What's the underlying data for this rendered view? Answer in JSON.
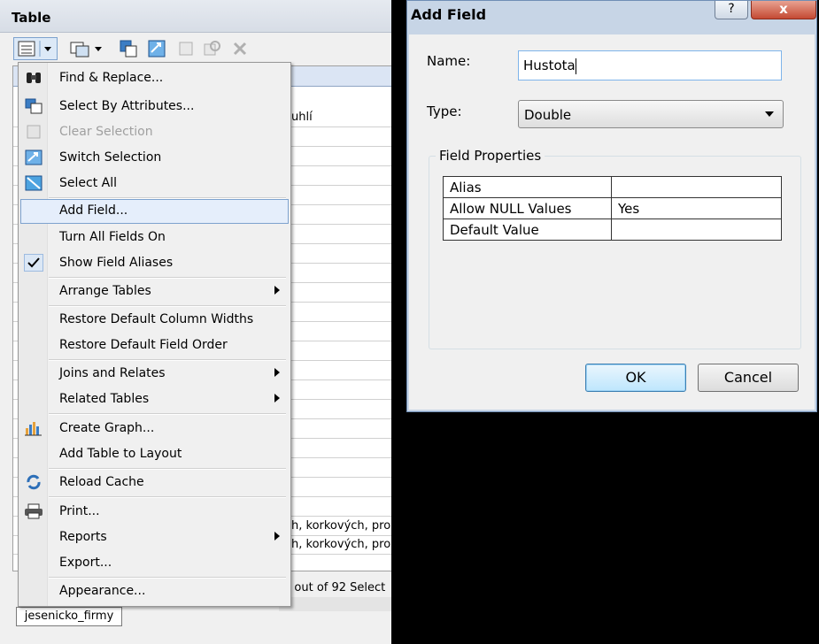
{
  "table_window": {
    "title": "Table",
    "tab_label": "jesenicko_firmy",
    "status_text": "0 out of 92 Select",
    "cell_values": [
      "uhlí",
      "h, korkových, pro",
      "h, korkových, pro"
    ]
  },
  "context_menu": {
    "items": [
      {
        "label": "Find & Replace...",
        "icon": "binoculars-icon"
      },
      {
        "label": "Select By Attributes...",
        "icon": "select-by-attributes-icon"
      },
      {
        "label": "Clear Selection",
        "icon": "clear-selection-icon",
        "disabled": true
      },
      {
        "label": "Switch Selection",
        "icon": "switch-selection-icon"
      },
      {
        "label": "Select All",
        "icon": "select-all-icon"
      },
      {
        "label": "Add Field...",
        "highlighted": true
      },
      {
        "label": "Turn All Fields On"
      },
      {
        "label": "Show Field Aliases",
        "icon": "checkmark-icon",
        "checked": true
      },
      {
        "label": "Arrange Tables",
        "submenu": true
      },
      {
        "label": "Restore Default Column Widths"
      },
      {
        "label": "Restore Default Field Order"
      },
      {
        "label": "Joins and Relates",
        "submenu": true
      },
      {
        "label": "Related Tables",
        "submenu": true
      },
      {
        "label": "Create Graph...",
        "icon": "graph-icon"
      },
      {
        "label": "Add Table to Layout"
      },
      {
        "label": "Reload Cache",
        "icon": "reload-icon"
      },
      {
        "label": "Print...",
        "icon": "printer-icon"
      },
      {
        "label": "Reports",
        "submenu": true
      },
      {
        "label": "Export..."
      },
      {
        "label": "Appearance..."
      }
    ]
  },
  "dialog": {
    "title": "Add Field",
    "help_label": "?",
    "close_label": "x",
    "name_label": "Name:",
    "name_value": "Hustota",
    "type_label": "Type:",
    "type_value": "Double",
    "field_properties_label": "Field Properties",
    "properties": [
      {
        "key": "Alias",
        "value": ""
      },
      {
        "key": "Allow NULL Values",
        "value": "Yes"
      },
      {
        "key": "Default Value",
        "value": ""
      }
    ],
    "ok_label": "OK",
    "cancel_label": "Cancel"
  },
  "colors": {
    "menu_highlight": "#e5eefb",
    "dialog_frame": "#c7d5e6",
    "close_button": "#c44a33"
  }
}
